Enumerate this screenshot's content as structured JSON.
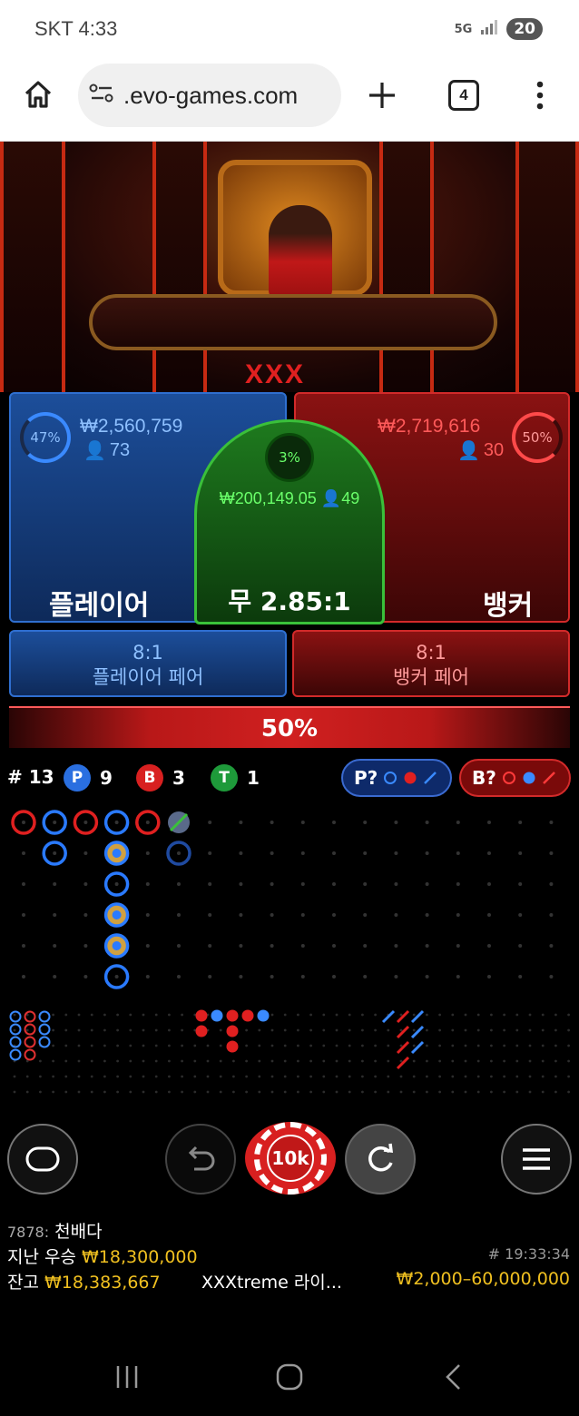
{
  "status_bar": {
    "carrier_time": "SKT 4:33",
    "network": "5G",
    "battery": "20"
  },
  "browser": {
    "url": "⚪.evo-games.com",
    "url_text": ".evo-games.com",
    "tabs_count": "4"
  },
  "video": {
    "table_sign": "XXX"
  },
  "player": {
    "percent": "47%",
    "amount": "₩2,560,759",
    "bettors": "73",
    "label": "플레이어"
  },
  "tie": {
    "percent": "3%",
    "amount": "₩200,149.05",
    "bettors": "49",
    "label": "무 2.85:1"
  },
  "banker": {
    "percent": "50%",
    "amount": "₩2,719,616",
    "bettors": "30",
    "label": "뱅커"
  },
  "player_pair": {
    "odds": "8:1",
    "label": "플레이어 페어"
  },
  "banker_pair": {
    "odds": "8:1",
    "label": "뱅커 페어"
  },
  "progress": {
    "label": "50%",
    "value": 0.5
  },
  "stats": {
    "round": "# 13",
    "p_letter": "P",
    "p_count": "9",
    "b_letter": "B",
    "b_count": "3",
    "t_letter": "T",
    "t_count": "1",
    "player_predict": "P?",
    "banker_predict": "B?"
  },
  "chip": {
    "label": "10k"
  },
  "info": {
    "user_line_id": "7878:",
    "user_line_msg": "천배다",
    "last_win_label": "지난 우승",
    "last_win_value": "₩18,300,000",
    "round_time": "# 19:33:34",
    "balance_label": "잔고",
    "balance_value": "₩18,383,667",
    "table_name": "XXXtreme 라이...",
    "bet_limits": "₩2,000–60,000,000"
  },
  "colors": {
    "player": "#2f6fd0",
    "banker": "#d22a2a",
    "tie": "#3ac03a",
    "gold": "#f0c020"
  }
}
